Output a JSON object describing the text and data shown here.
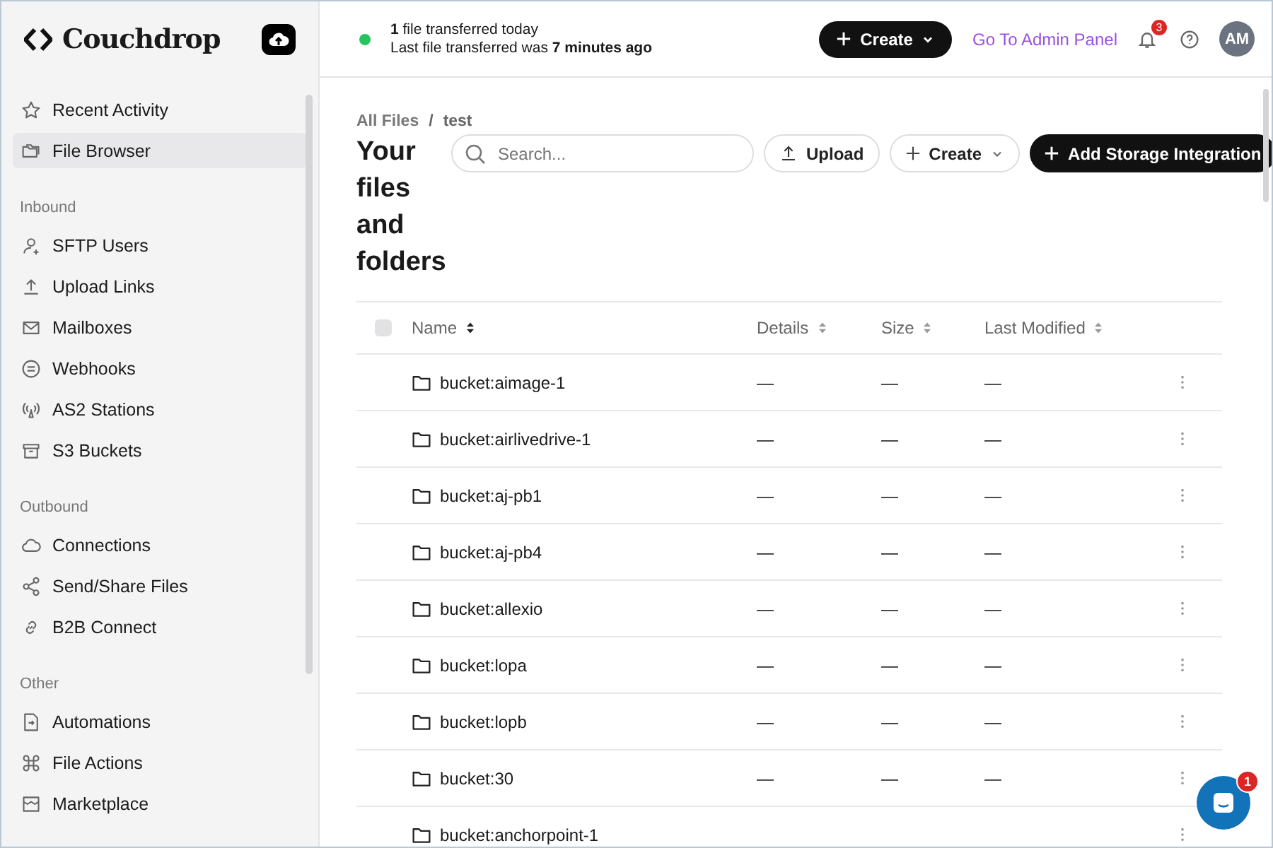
{
  "sidebar": {
    "logo": "Couchdrop",
    "sections": [
      {
        "items": [
          {
            "label": "Recent Activity",
            "selected": false
          },
          {
            "label": "File Browser",
            "selected": true
          }
        ]
      },
      {
        "heading": "Inbound",
        "items": [
          {
            "label": "SFTP Users",
            "selected": false
          },
          {
            "label": "Upload Links",
            "selected": false
          },
          {
            "label": "Mailboxes",
            "selected": false
          },
          {
            "label": "Webhooks",
            "selected": false
          },
          {
            "label": "AS2 Stations",
            "selected": false
          },
          {
            "label": "S3 Buckets",
            "selected": false
          }
        ]
      },
      {
        "heading": "Outbound",
        "items": [
          {
            "label": "Connections",
            "selected": false
          },
          {
            "label": "Send/Share Files",
            "selected": false
          },
          {
            "label": "B2B Connect",
            "selected": false
          }
        ]
      },
      {
        "heading": "Other",
        "items": [
          {
            "label": "Automations",
            "selected": false
          },
          {
            "label": "File Actions",
            "selected": false
          },
          {
            "label": "Marketplace",
            "selected": false
          }
        ]
      }
    ]
  },
  "top_bar": {
    "status_line_1": "**1** file transferred today",
    "status_line_2": "Last file transferred was **7 minutes ago**",
    "create_button": "Create",
    "admin_link": "Go To Admin Panel",
    "notification_count": "3",
    "avatar": "AM"
  },
  "breadcrumb": {
    "items": [
      "All Files",
      "test"
    ],
    "separator": "/"
  },
  "page_title": "Your files and folders",
  "toolbar": {
    "search": {
      "placeholder": "Search..."
    },
    "upload_button": "Upload",
    "create_button": "Create",
    "add_button": "Add Storage Integration"
  },
  "table": {
    "select_all_checked": false,
    "columns": [
      "Name",
      "Details",
      "Size",
      "Last Modified"
    ],
    "rows": [
      {
        "name": "bucket:aimage-1",
        "details": "—",
        "size": "—",
        "last_modified": "—"
      },
      {
        "name": "bucket:airlivedrive-1",
        "details": "—",
        "size": "—",
        "last_modified": "—"
      },
      {
        "name": "bucket:aj-pb1",
        "details": "—",
        "size": "—",
        "last_modified": "—"
      },
      {
        "name": "bucket:aj-pb4",
        "details": "—",
        "size": "—",
        "last_modified": "—"
      },
      {
        "name": "bucket:allexio",
        "details": "—",
        "size": "—",
        "last_modified": "—"
      },
      {
        "name": "bucket:lopa",
        "details": "—",
        "size": "—",
        "last_modified": "—"
      },
      {
        "name": "bucket:lopb",
        "details": "—",
        "size": "—",
        "last_modified": "—"
      },
      {
        "name": "bucket:30",
        "details": "—",
        "size": "—",
        "last_modified": "—"
      },
      {
        "name": "bucket:anchorpoint-1"
      }
    ]
  },
  "chat_badge": "1"
}
